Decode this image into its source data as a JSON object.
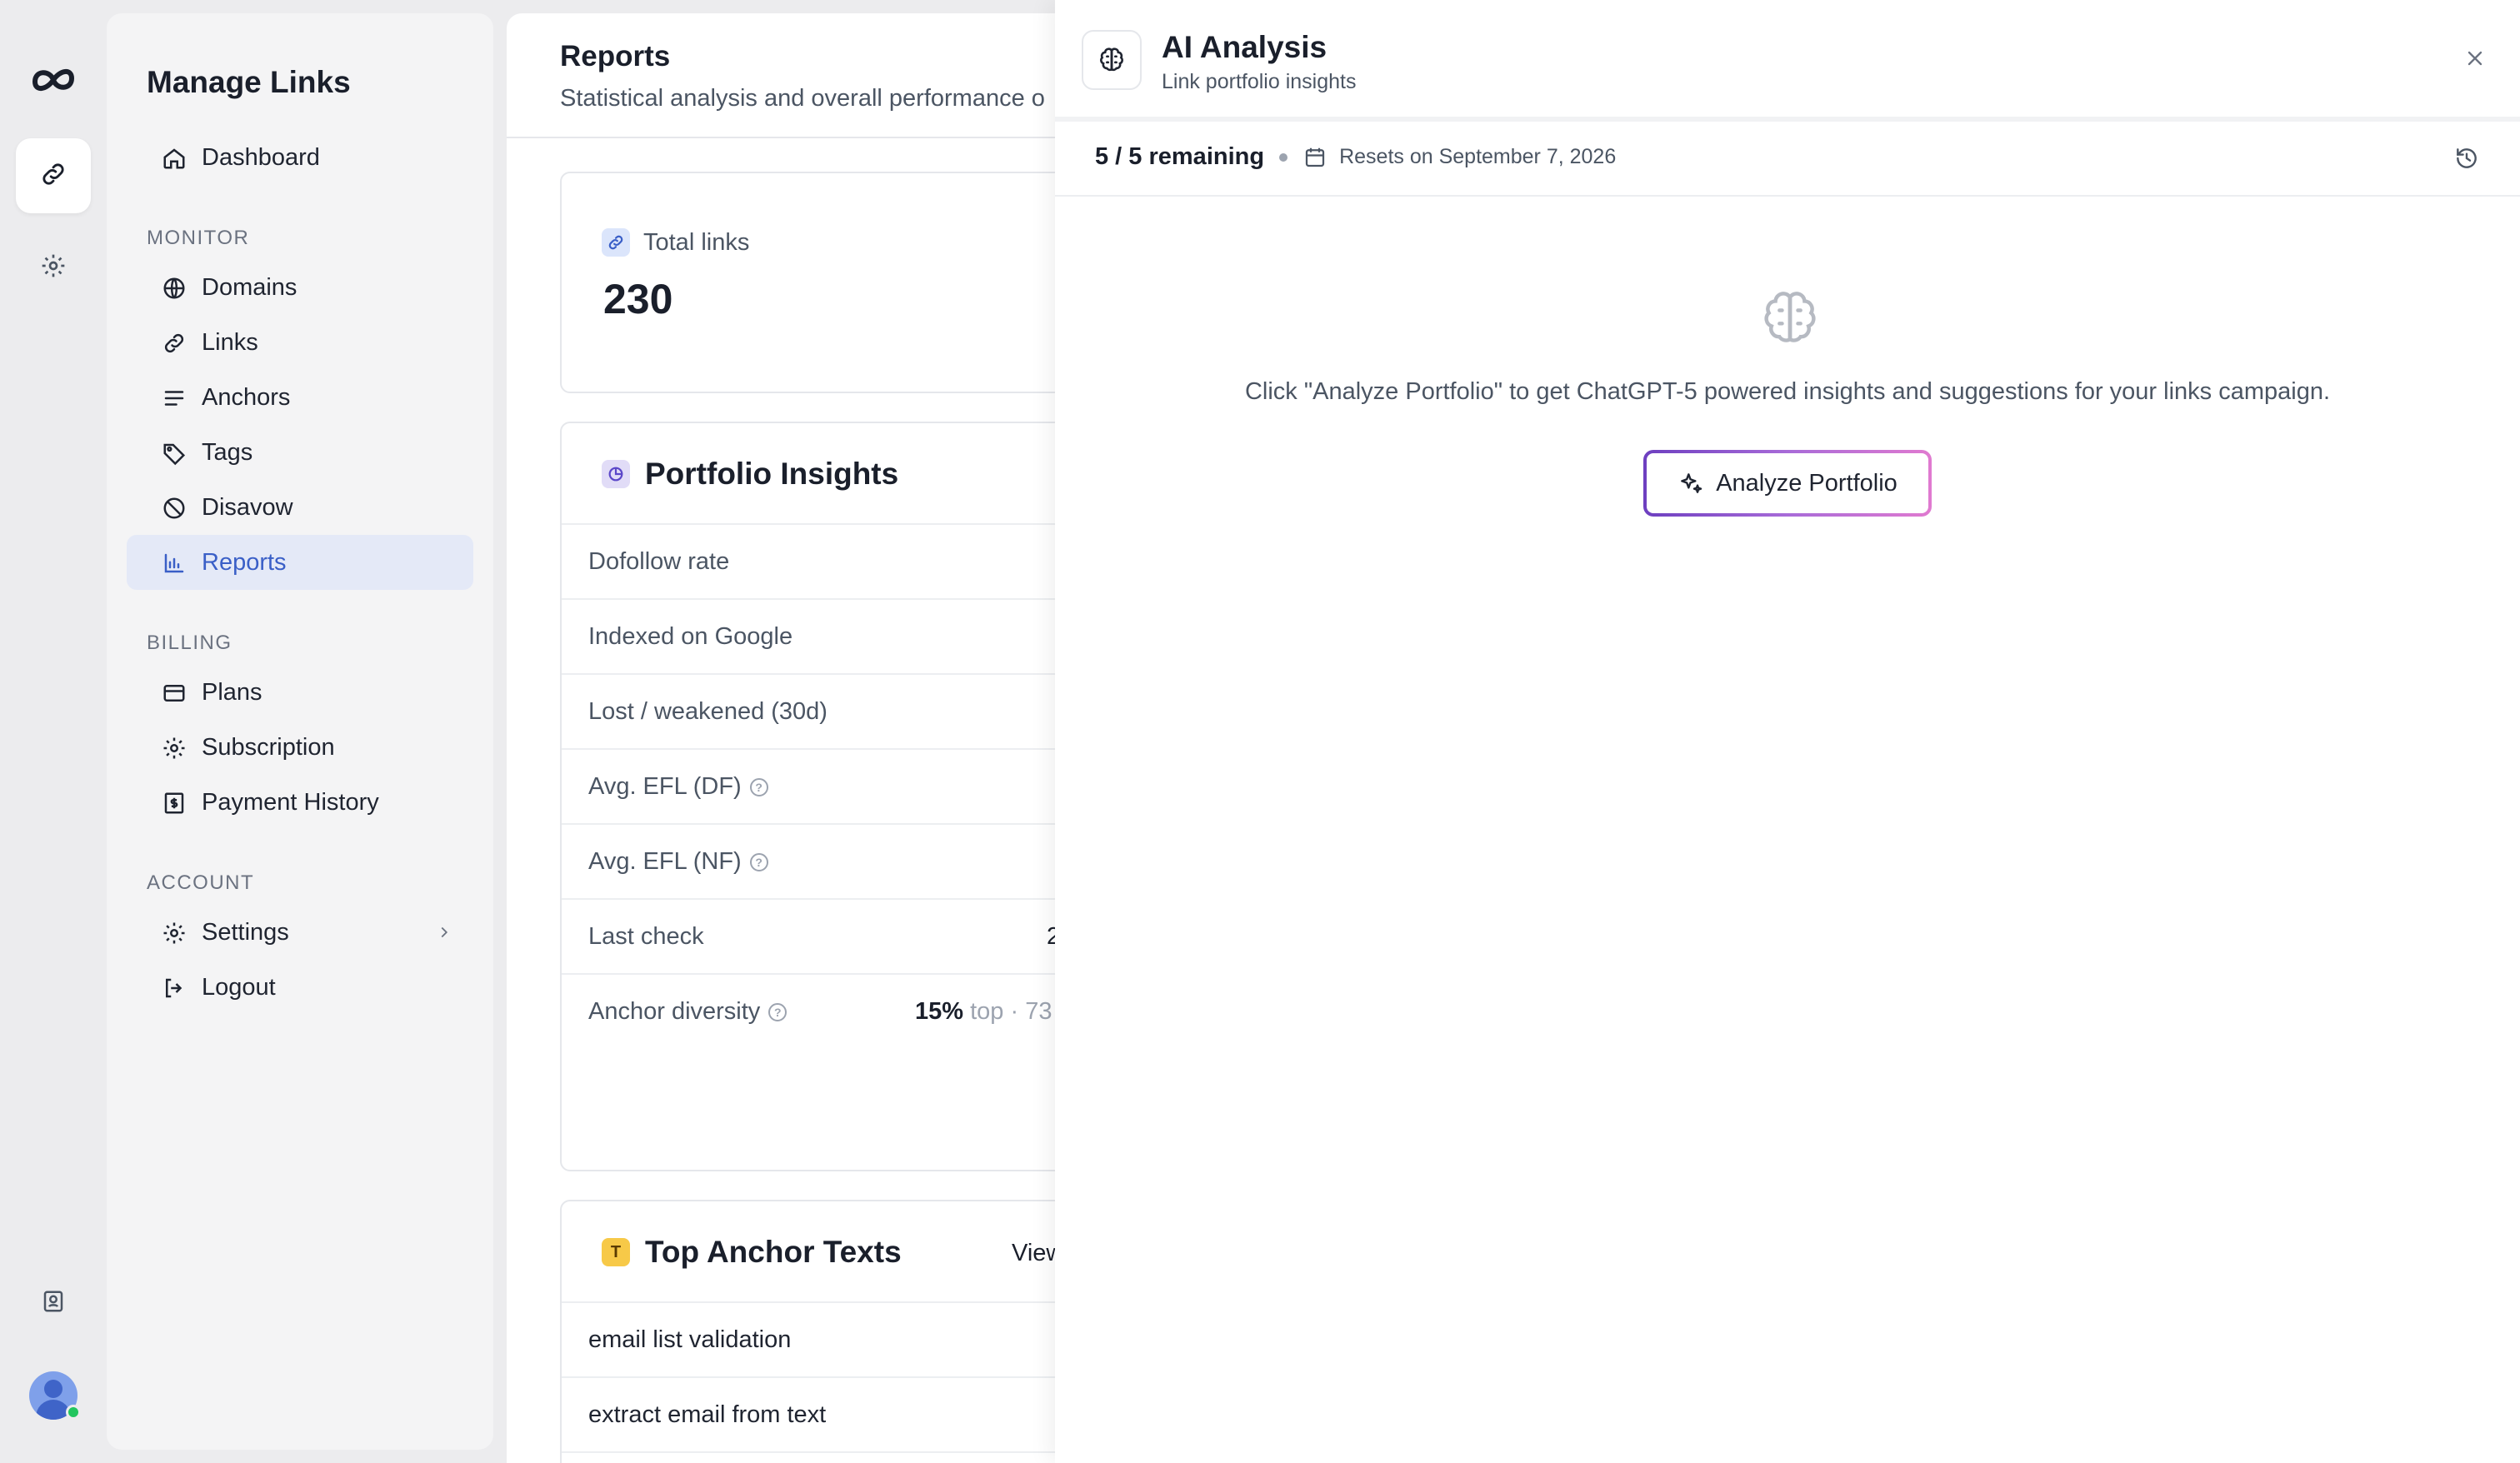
{
  "sidebar": {
    "title": "Manage Links",
    "dashboard": "Dashboard",
    "sections": {
      "monitor": "MONITOR",
      "billing": "BILLING",
      "account": "ACCOUNT"
    },
    "monitor_items": [
      "Domains",
      "Links",
      "Anchors",
      "Tags",
      "Disavow",
      "Reports"
    ],
    "billing_items": [
      "Plans",
      "Subscription",
      "Payment History"
    ],
    "account_items": [
      "Settings",
      "Logout"
    ],
    "active_item": "Reports"
  },
  "main": {
    "title": "Reports",
    "subtitle": "Statistical analysis and overall performance o",
    "total_links": {
      "label": "Total links",
      "value": "230"
    },
    "insights": {
      "title": "Portfolio Insights",
      "rows": [
        {
          "label": "Dofollow rate"
        },
        {
          "label": "Indexed on Google"
        },
        {
          "label": "Lost / weakened (30d)"
        },
        {
          "label": "Avg. EFL (DF)"
        },
        {
          "label": "Avg. EFL (NF)"
        },
        {
          "label": "Last check",
          "value": "2"
        },
        {
          "label": "Anchor diversity",
          "value": "15%",
          "value_muted": "top · 73"
        }
      ]
    },
    "anchors": {
      "title": "Top Anchor Texts",
      "view_label": "View",
      "rows": [
        "email list validation",
        "extract email from text"
      ]
    }
  },
  "ai_panel": {
    "title": "AI Analysis",
    "subtitle": "Link portfolio insights",
    "remaining": "5 / 5 remaining",
    "reset_text": "Resets on September 7, 2026",
    "empty_text": "Click \"Analyze Portfolio\" to get ChatGPT-5 powered insights and suggestions for your links campaign.",
    "analyze_label": "Analyze Portfolio"
  },
  "colors": {
    "accent": "#3a5fc7",
    "active_bg": "#e4e9f7",
    "button_gradient_start": "#6d3fc0",
    "button_gradient_end": "#e07ad0"
  }
}
